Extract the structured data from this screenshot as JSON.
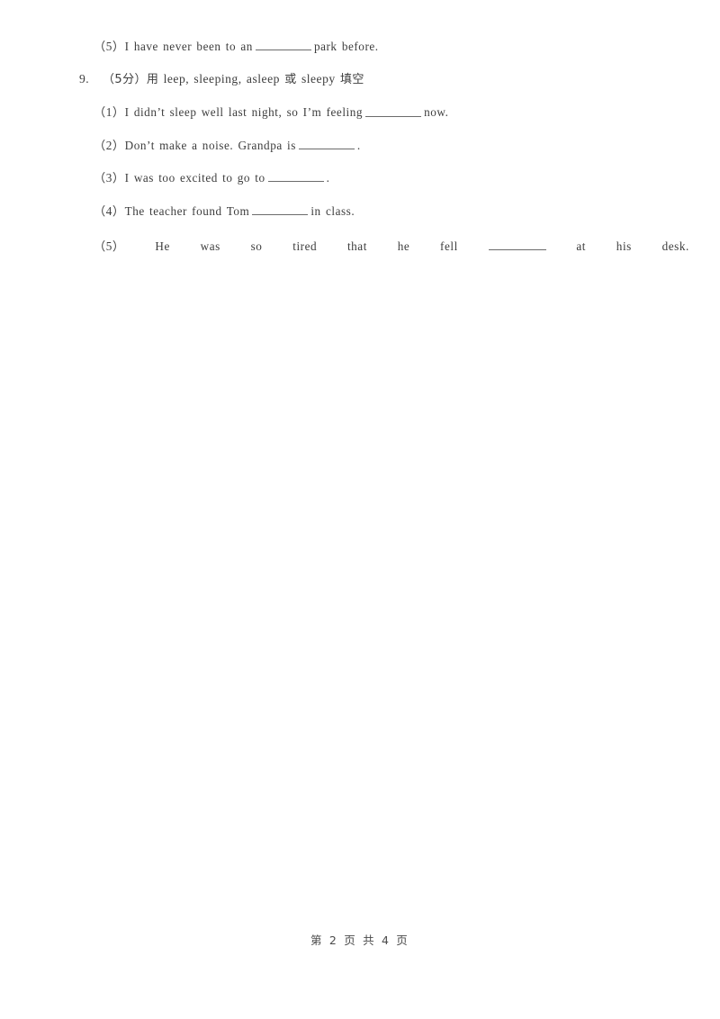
{
  "page": {
    "background_color": "#ffffff",
    "text_color": "#3d3d3d",
    "rule_color": "#6b6b6b"
  },
  "carryover_item": {
    "label": "（5）",
    "text_before": "I have never been to an",
    "text_after": "park before."
  },
  "question": {
    "number": "9.",
    "score_note": "（5分）",
    "instruction_zh": "用",
    "word_bank": "leep, sleeping, asleep",
    "conjunction_zh": "或",
    "word_bank_2": "sleepy",
    "action_zh": "填空",
    "full_heading": "9.　（5分）用 leep, sleeping, asleep 或 sleepy 填空"
  },
  "items": [
    {
      "label": "（1）",
      "text_before": "I didn’t sleep well last night, so I’m feeling",
      "text_after": "now."
    },
    {
      "label": "（2）",
      "text_before": "Don’t make a noise. Grandpa is",
      "text_after": "."
    },
    {
      "label": "（3）",
      "text_before": "I was too excited to go to",
      "text_after": "."
    },
    {
      "label": "（4）",
      "text_before": "The teacher found Tom",
      "text_after": "in class."
    }
  ],
  "justified_item": {
    "label": "（5）",
    "tokens": [
      "He",
      "was",
      "so",
      "tired",
      "that",
      "he",
      "fell"
    ],
    "tokens_after": [
      "at",
      "his",
      "desk."
    ]
  },
  "footer": {
    "text": "第 2 页 共 4 页",
    "current_page": "2",
    "total_pages": "4"
  }
}
